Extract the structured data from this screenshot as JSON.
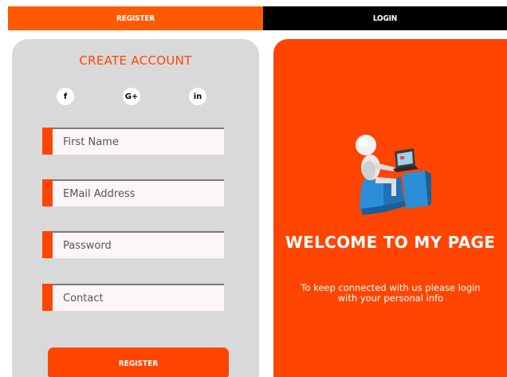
{
  "tabs": {
    "register_label": "REGISTER",
    "login_label": "LOGIN"
  },
  "form": {
    "title": "CREATE ACCOUNT",
    "social": [
      {
        "icon": "facebook-icon",
        "label": "f"
      },
      {
        "icon": "google-plus-icon",
        "label": "G+"
      },
      {
        "icon": "linkedin-icon",
        "label": "in"
      }
    ],
    "fields": {
      "first_name_placeholder": "First Name",
      "email_placeholder": "EMail Address",
      "password_placeholder": "Password",
      "contact_placeholder": "Contact"
    },
    "register_button_label": "REGISTER"
  },
  "welcome": {
    "title": "WELCOME TO MY PAGE",
    "message": "To keep connected with us please login with your personal info"
  },
  "colors": {
    "accent": "#ff4500",
    "tab_active": "#ff5a00",
    "tab_inactive": "#000000",
    "card_bg": "#d9d9d9"
  }
}
